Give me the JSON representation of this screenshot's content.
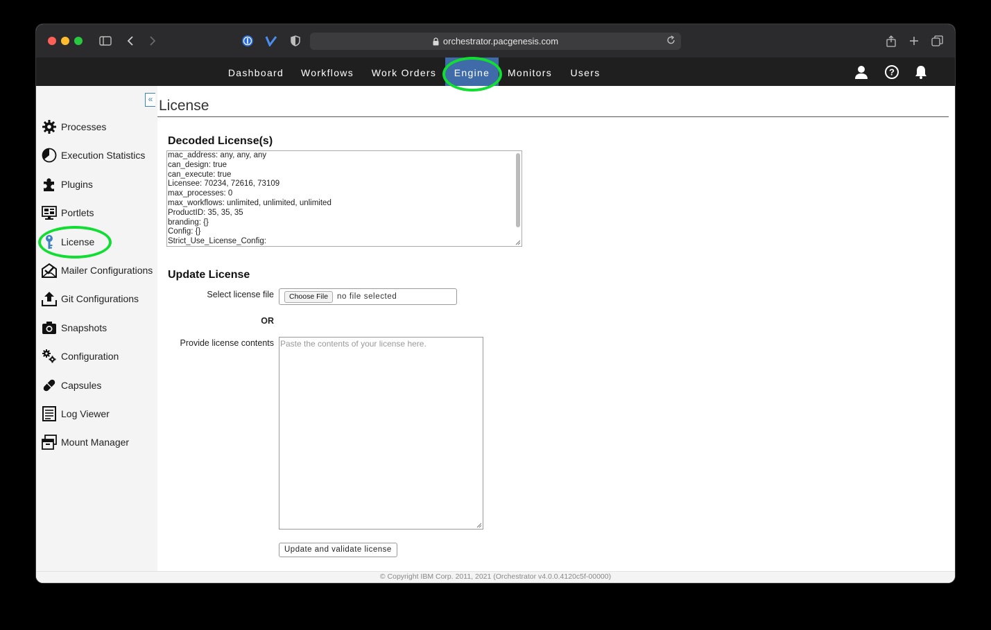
{
  "browser": {
    "url": "orchestrator.pacgenesis.com"
  },
  "nav": {
    "items": [
      {
        "label": "Dashboard"
      },
      {
        "label": "Workflows"
      },
      {
        "label": "Work Orders"
      },
      {
        "label": "Engine",
        "active": true
      },
      {
        "label": "Monitors"
      },
      {
        "label": "Users"
      }
    ],
    "icons": [
      "user-icon",
      "help-icon",
      "bell-icon"
    ],
    "active_color": "#3f6ba8"
  },
  "sidebar": {
    "collapse_label": "«",
    "items": [
      {
        "label": "Processes",
        "icon": "gear-icon"
      },
      {
        "label": "Execution Statistics",
        "icon": "pie-chart-icon"
      },
      {
        "label": "Plugins",
        "icon": "puzzle-icon"
      },
      {
        "label": "Portlets",
        "icon": "monitor-icon"
      },
      {
        "label": "License",
        "icon": "key-icon",
        "active": true
      },
      {
        "label": "Mailer Configurations",
        "icon": "mail-icon"
      },
      {
        "label": "Git Configurations",
        "icon": "upload-icon"
      },
      {
        "label": "Snapshots",
        "icon": "camera-icon"
      },
      {
        "label": "Configuration",
        "icon": "gears-icon"
      },
      {
        "label": "Capsules",
        "icon": "capsule-icon"
      },
      {
        "label": "Log Viewer",
        "icon": "log-icon"
      },
      {
        "label": "Mount Manager",
        "icon": "archive-icon"
      }
    ]
  },
  "page": {
    "title": "License",
    "decoded_heading": "Decoded License(s)",
    "decoded_lines": [
      "mac_address: any, any, any",
      "can_design: true",
      "can_execute: true",
      "Licensee: 70234, 72616, 73109",
      "max_processes: 0",
      "max_workflows: unlimited, unlimited, unlimited",
      "ProductID: 35, 35, 35",
      "branding: {}",
      "Config: {}",
      "Strict_Use_License_Config:"
    ],
    "update_heading": "Update License",
    "select_file_label": "Select license file",
    "choose_file_button": "Choose File",
    "no_file_text": "no file selected",
    "or_text": "OR",
    "contents_label": "Provide license contents",
    "contents_placeholder": "Paste the contents of your license here.",
    "submit_button": "Update and validate license"
  },
  "footer": {
    "text": "© Copyright IBM Corp. 2011, 2021 (Orchestrator v4.0.0.4120c5f-00000)"
  },
  "highlight_color": "#11dd33"
}
